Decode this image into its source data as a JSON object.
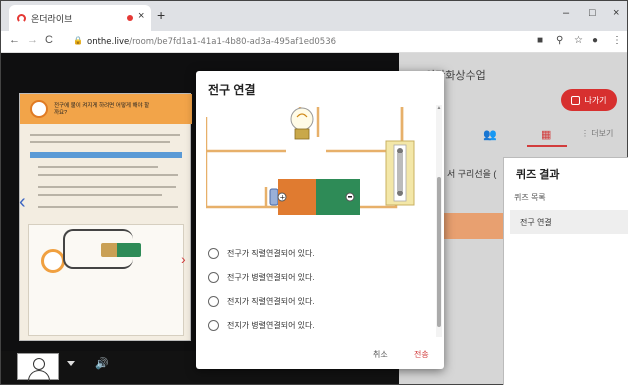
{
  "browser": {
    "tab_title": "온더라이브",
    "tab_close": "×",
    "new_tab": "+",
    "window": {
      "minimize": "–",
      "maximize": "□",
      "close": "×"
    },
    "nav": {
      "back": "←",
      "forward": "→",
      "reload": "C"
    },
    "url_host": "onthe.live",
    "url_path": "/room/be7fd1a1-41a1-4b80-ad3a-495af1ed0536",
    "toolbar_icons": [
      "camera-icon",
      "key-icon",
      "star-icon",
      "profile-icon",
      "menu-icon"
    ]
  },
  "slide": {
    "title": "전구에 불이 켜지게 하려면 어떻게 해야 할까요?",
    "prev": "‹",
    "next": "›"
  },
  "room": {
    "title": "의관화상수업",
    "exit_label": "나가기",
    "more_label": "⋮ 더보기",
    "message_fragment": "서 구리선을 (",
    "icons": {
      "people": "people-icon",
      "chart": "chart-icon"
    }
  },
  "quiz": {
    "title": "전구 연결",
    "options": [
      "전구가 직렬연결되어 있다.",
      "전구가 병렬연결되어 있다.",
      "전지가 직렬연결되어 있다.",
      "전지가 병렬연결되어 있다."
    ],
    "cancel": "취소",
    "send": "전송"
  },
  "results": {
    "title": "퀴즈 결과",
    "list_heading": "퀴즈 목록",
    "items": [
      "전구 연결"
    ]
  },
  "colors": {
    "accent": "#d23c3c",
    "battery_orange": "#e07b30",
    "battery_green": "#2e8b57",
    "wire": "#e7b06a"
  }
}
